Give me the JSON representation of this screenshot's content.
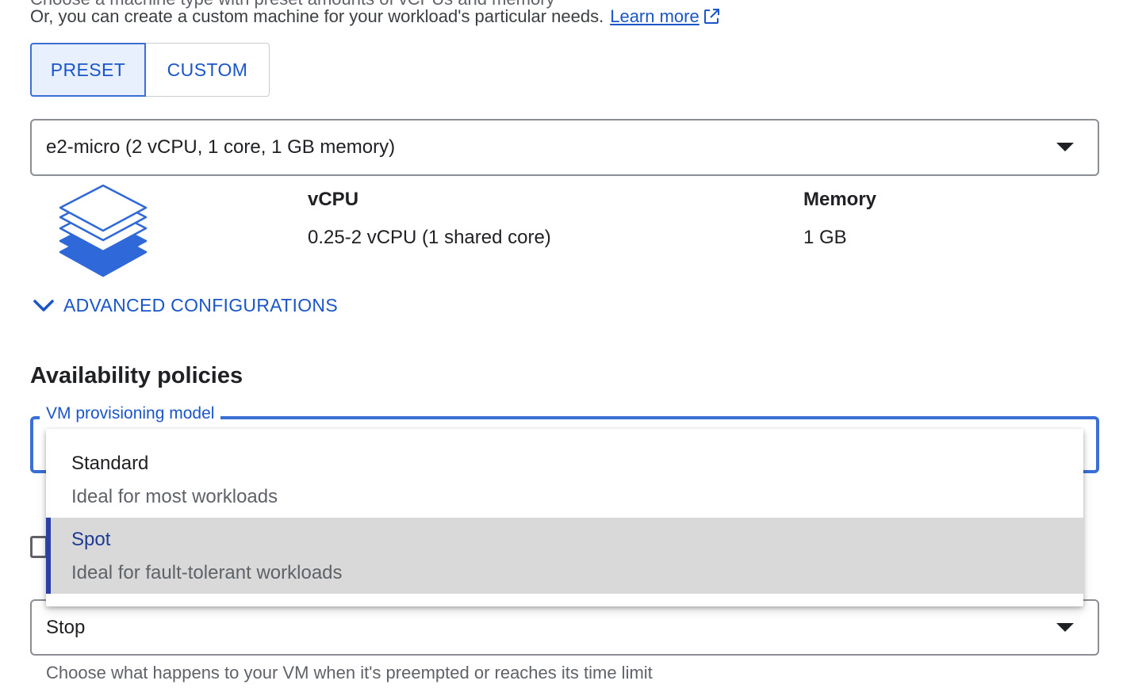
{
  "intro": {
    "cut_line": "Choose a machine type with preset amounts of vCPUs and memory",
    "text": "Or, you can create a custom machine for your workload's particular needs.",
    "link_label": "Learn more",
    "link_icon": "external-link-icon"
  },
  "machine_config_tabs": [
    {
      "label": "PRESET",
      "selected": true
    },
    {
      "label": "CUSTOM",
      "selected": false
    }
  ],
  "machine_type": {
    "value": "e2-micro (2 vCPU, 1 core, 1 GB memory)",
    "icon": "chevron-down-icon"
  },
  "specs": {
    "icon": "layers-icon",
    "vcpu_header": "vCPU",
    "vcpu_value": "0.25-2 vCPU (1 shared core)",
    "memory_header": "Memory",
    "memory_value": "1 GB"
  },
  "advanced": {
    "label": "ADVANCED CONFIGURATIONS",
    "icon": "chevron-down-icon"
  },
  "availability": {
    "title": "Availability policies",
    "provisioning_label": "VM provisioning model",
    "options": [
      {
        "title": "Standard",
        "description": "Ideal for most workloads",
        "highlighted": false
      },
      {
        "title": "Spot",
        "description": "Ideal for fault-tolerant workloads",
        "highlighted": true
      }
    ]
  },
  "termination": {
    "value": "Stop",
    "hint": "Choose what happens to your VM when it's preempted or reaches its time limit"
  },
  "colors": {
    "accent": "#1a56c8",
    "field_focus": "#3b6fd4",
    "highlight_bg": "#d9d9d9",
    "highlight_bar": "#2b3fa8"
  }
}
